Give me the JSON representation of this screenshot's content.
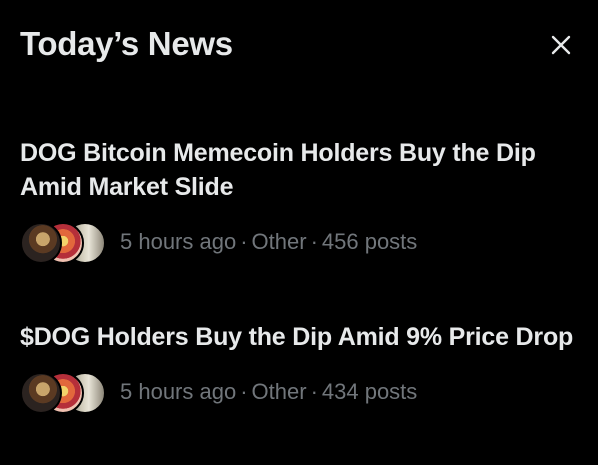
{
  "header": {
    "title": "Today’s News",
    "close_icon": "close-icon"
  },
  "news": [
    {
      "headline": "DOG Bitcoin Memecoin Holders Buy the Dip Amid Market Slide",
      "time": "5 hours ago",
      "category": "Other",
      "posts": "456 posts"
    },
    {
      "headline": "$DOG Holders Buy the Dip Amid 9% Price Drop",
      "time": "5 hours ago",
      "category": "Other",
      "posts": "434 posts"
    }
  ],
  "colors": {
    "background": "#000000",
    "primary_text": "#e7e9ea",
    "secondary_text": "#71767b"
  }
}
